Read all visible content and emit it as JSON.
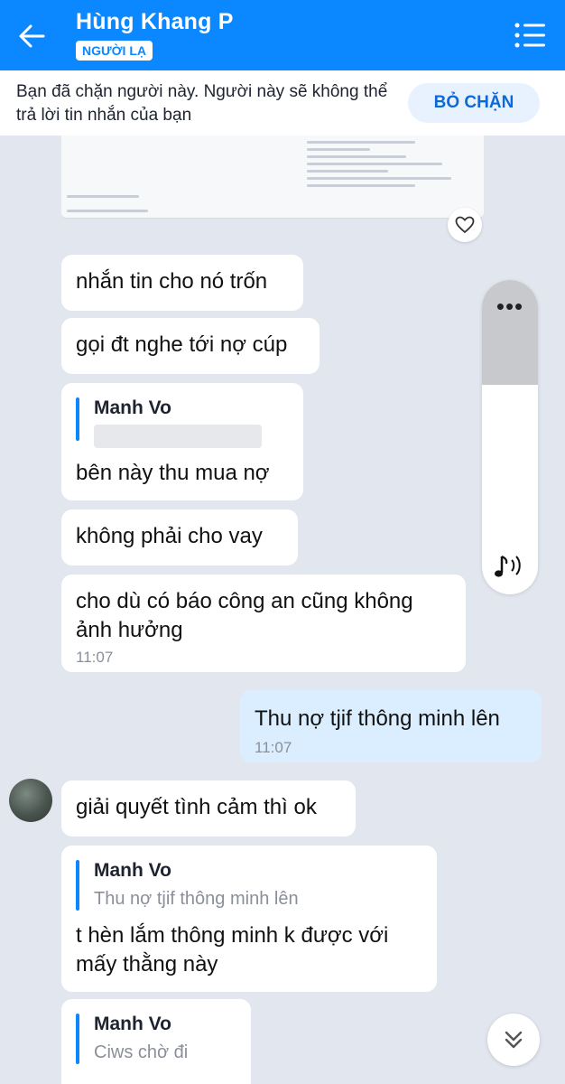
{
  "header": {
    "title": "Hùng Khang P",
    "badge": "NGƯỜI LẠ",
    "accent": "#0b87ff"
  },
  "banner": {
    "text": "Bạn đã chặn người này. Người này sẽ không thể trả lời tin nhắn của bạn",
    "unblock_label": "BỎ CHẶN"
  },
  "icons": {
    "back": "arrow-left-icon",
    "menu": "list-menu-icon",
    "heart": "heart-icon",
    "more": "more-dots-icon",
    "sound": "music-sound-icon",
    "scroll": "double-chevron-down-icon"
  },
  "media": {
    "more_glyph": "•••"
  },
  "messages": [
    {
      "text": "nhắn tin cho nó trốn"
    },
    {
      "text": "gọi đt nghe tới nợ cúp"
    },
    {
      "quote_name": "Manh Vo",
      "text": "bên  này thu mua nợ"
    },
    {
      "text": "không phải cho vay"
    },
    {
      "text_line1": "cho dù có báo công an cũng không",
      "text_line2": "ảnh hưởng",
      "time": "11:07"
    },
    {
      "text": "Thu nợ tjif thông minh lên",
      "time": "11:07"
    },
    {
      "text": "giải quyết tình cảm thì ok"
    },
    {
      "quote_name": "Manh Vo",
      "quote_text": "Thu nợ tjif thông minh lên",
      "text_line1": "t hèn lắm thông minh k được với",
      "text_line2": "mấy thằng này"
    },
    {
      "quote_name": "Manh Vo",
      "quote_text": "Ciws chờ đi"
    }
  ]
}
